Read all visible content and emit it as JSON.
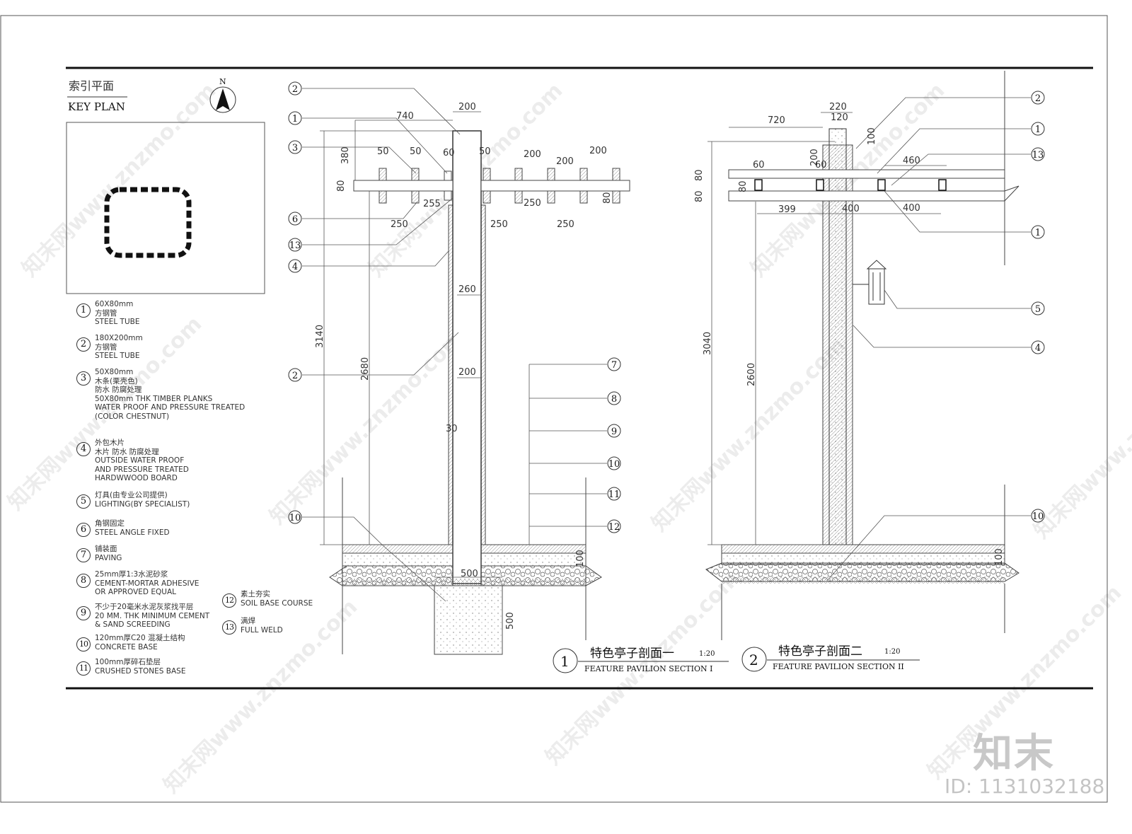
{
  "key_plan": {
    "title_cn": "索引平面",
    "title_en": "KEY PLAN",
    "north": "N"
  },
  "legend": [
    {
      "num": "1",
      "lines": [
        "60X80mm",
        "方钢管",
        "STEEL TUBE"
      ]
    },
    {
      "num": "2",
      "lines": [
        "180X200mm",
        "方钢管",
        "STEEL TUBE"
      ]
    },
    {
      "num": "3",
      "lines": [
        "50X80mm",
        "木条(栗壳色)",
        "防水 防腐处理",
        "50X80mm THK TIMBER PLANKS",
        "WATER PROOF AND PRESSURE TREATED",
        "(COLOR CHESTNUT)"
      ]
    },
    {
      "num": "4",
      "lines": [
        "外包木片",
        "木片 防水 防腐处理",
        "OUTSIDE WATER PROOF",
        "AND PRESSURE TREATED",
        "HARDWWOOD BOARD"
      ]
    },
    {
      "num": "5",
      "lines": [
        "灯具(由专业公司提供)",
        "LIGHTING(BY SPECIALIST)"
      ]
    },
    {
      "num": "6",
      "lines": [
        "角钢固定",
        "STEEL ANGLE FIXED"
      ]
    },
    {
      "num": "7",
      "lines": [
        "铺装面",
        "PAVING"
      ]
    },
    {
      "num": "8",
      "lines": [
        "25mm厚1:3水泥砂浆",
        "CEMENT-MORTAR ADHESIVE",
        "OR APPROVED EQUAL"
      ]
    },
    {
      "num": "9",
      "lines": [
        "不少于20毫米水泥灰浆找平层",
        "20 MM. THK MINIMUM CEMENT",
        "& SAND SCREEDING"
      ]
    },
    {
      "num": "10",
      "lines": [
        "120mm厚C20 混凝土结构",
        "CONCRETE BASE"
      ]
    },
    {
      "num": "11",
      "lines": [
        "100mm厚碎石垫层",
        "CRUSHED STONES BASE"
      ]
    },
    {
      "num": "12",
      "lines": [
        "素土夯实",
        "SOIL BASE COURSE"
      ]
    },
    {
      "num": "13",
      "lines": [
        "满焊",
        "FULL WELD"
      ]
    }
  ],
  "section1": {
    "title_cn": "特色亭子剖面一",
    "scale": "1:20",
    "title_en": "FEATURE PAVILION SECTION I",
    "num": "1",
    "dims": [
      "200",
      "740",
      "380",
      "80",
      "50",
      "50",
      "60",
      "50",
      "200",
      "200",
      "200",
      "255",
      "250",
      "250",
      "250",
      "250",
      "80",
      "260",
      "3140",
      "2680",
      "200",
      "30",
      "500",
      "500",
      "100"
    ],
    "callouts_left": [
      "2",
      "1",
      "3",
      "6",
      "13",
      "4",
      "2",
      "10"
    ],
    "callouts_right": [
      "7",
      "8",
      "9",
      "10",
      "11",
      "12"
    ]
  },
  "section2": {
    "title_cn": "特色亭子剖面二",
    "scale": "1:20",
    "title_en": "FEATURE PAVILION SECTION II",
    "num": "2",
    "dims": [
      "220",
      "120",
      "720",
      "100",
      "200",
      "80",
      "80",
      "80",
      "60",
      "60",
      "460",
      "399",
      "400",
      "400",
      "3040",
      "2600",
      "100"
    ],
    "callouts": [
      "2",
      "1",
      "13",
      "1",
      "5",
      "4",
      "10"
    ]
  },
  "watermark": {
    "text": "知末网www.znzmo.com",
    "logo": "知末",
    "id": "ID: 1131032188"
  }
}
